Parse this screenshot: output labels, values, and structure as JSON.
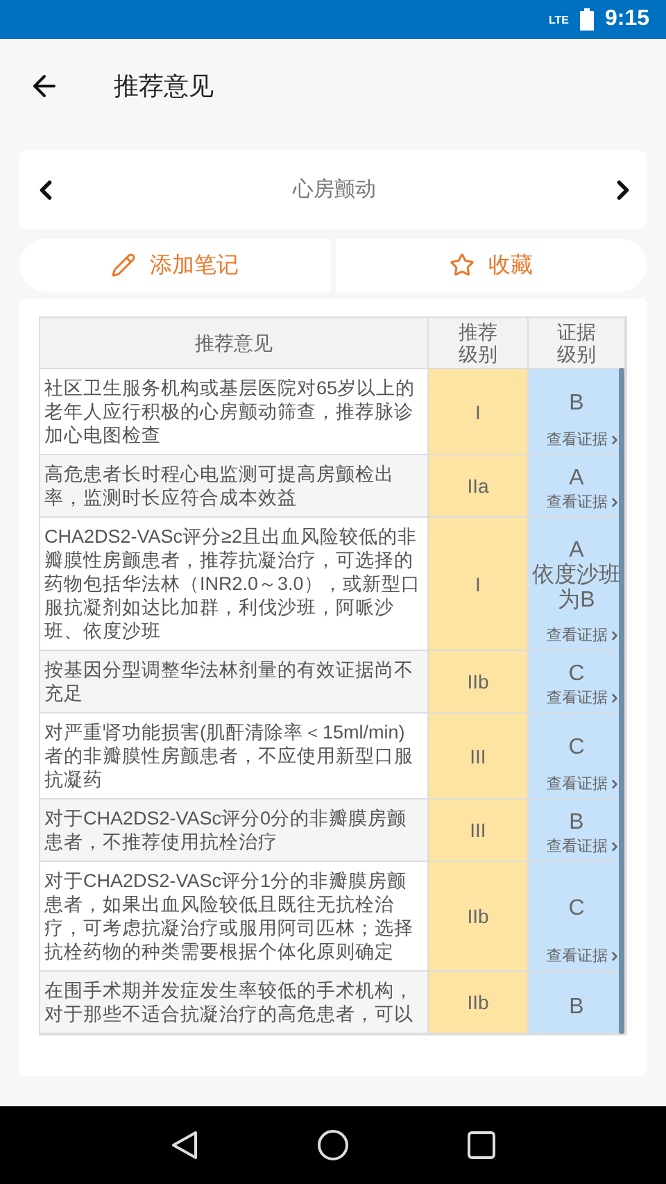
{
  "status_bar": {
    "network": "LTE",
    "time": "9:15"
  },
  "header": {
    "title": "推荐意见"
  },
  "topic_nav": {
    "title": "心房颤动"
  },
  "actions": [
    {
      "kind": "note",
      "label": "添加笔记"
    },
    {
      "kind": "favorite",
      "label": "收藏"
    }
  ],
  "table": {
    "columns": [
      "推荐意见",
      "推荐级别",
      "证据级别"
    ],
    "rows": [
      {
        "text": "社区卫生服务机构或基层医院对65岁以上的老年人应行积极的心房颤动筛查，推荐脉诊加心电图检查",
        "grade": "I",
        "evidence": "B",
        "link": "查看证据"
      },
      {
        "text": "高危患者长时程心电监测可提高房颤检出率，监测时长应符合成本效益",
        "grade": "IIa",
        "evidence": "A",
        "link": "查看证据"
      },
      {
        "text": "CHA2DS2-VASc评分≥2且出血风险较低的非瓣膜性房颤患者，推荐抗凝治疗，可选择的药物包括华法林（INR2.0～3.0），或新型口服抗凝剂如达比加群，利伐沙班，阿哌沙班、依度沙班",
        "grade": "I",
        "evidence": "A",
        "evidence_note": "依度沙班为B",
        "link": "查看证据"
      },
      {
        "text": "按基因分型调整华法林剂量的有效证据尚不充足",
        "grade": "IIb",
        "evidence": "C",
        "link": "查看证据"
      },
      {
        "text": "对严重肾功能损害(肌酐清除率＜15ml/min)者的非瓣膜性房颤患者，不应使用新型口服抗凝药",
        "grade": "III",
        "evidence": "C",
        "link": "查看证据"
      },
      {
        "text": "对于CHA2DS2-VASc评分0分的非瓣膜房颤患者，不推荐使用抗栓治疗",
        "grade": "III",
        "evidence": "B",
        "link": "查看证据"
      },
      {
        "text": "对于CHA2DS2-VASc评分1分的非瓣膜房颤患者，如果出血风险较低且既往无抗栓治疗，可考虑抗凝治疗或服用阿司匹林；选择抗栓药物的种类需要根据个体化原则确定",
        "grade": "IIb",
        "evidence": "C",
        "link": "查看证据"
      },
      {
        "text": "在围手术期并发症发生率较低的手术机构，对于那些不适合抗凝治疗的高危患者，可以",
        "grade": "IIb",
        "evidence": "B"
      }
    ]
  }
}
